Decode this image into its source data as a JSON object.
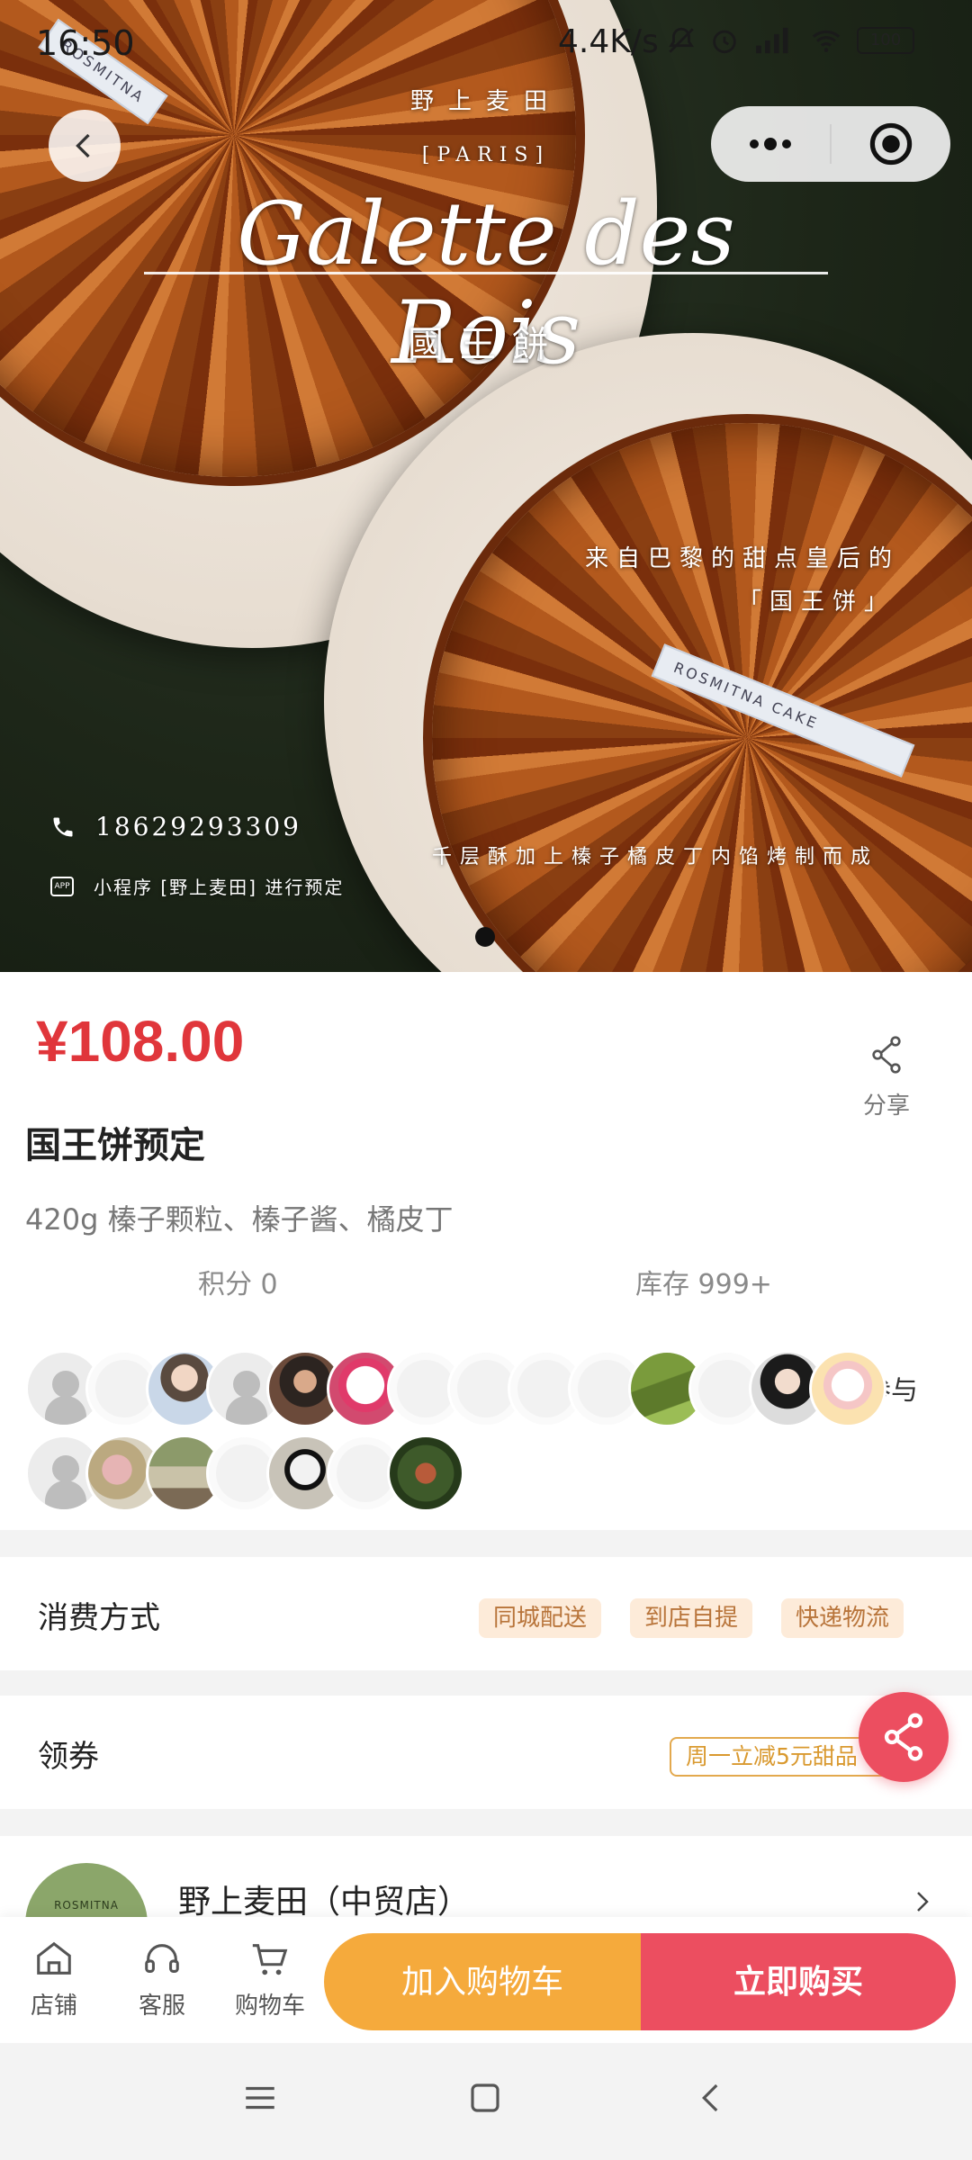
{
  "status_bar": {
    "time": "16:50",
    "net_speed": "4.4K/s",
    "battery": "100"
  },
  "hero": {
    "brand_cn": "野上麦田",
    "brand_city": "[PARIS]",
    "script_title": "Galette des Rois",
    "subtitle_cn": "國王餅",
    "tagline_line1": "来自巴黎的甜点皇后的",
    "tagline_line2": "「国王饼」",
    "tagline_line3": "千层酥加上榛子橘皮丁内馅烤制而成",
    "phone": "18629293309",
    "app_note": "小程序 [野上麦田] 进行预定",
    "app_badge": "APP",
    "ribbon_text_1": "ROSMITNA",
    "ribbon_text_2": "ROSMITNA  CAKE",
    "carousel_index": 1,
    "carousel_total": 1
  },
  "product": {
    "price": "¥108.00",
    "share_label": "分享",
    "title": "国王饼预定",
    "description": "420g 榛子颗粒、榛子酱、橘皮丁",
    "points": "积分 0",
    "stock": "库存 999+",
    "join_label": "参与"
  },
  "participants": {
    "row1": [
      "default",
      "ghost",
      "photo-girl",
      "default",
      "photo-woman",
      "photo-dog",
      "ghost",
      "ghost",
      "ghost",
      "ghost",
      "photo-room",
      "ghost",
      "photo-girl2",
      "photo-cartoon"
    ],
    "row2": [
      "default",
      "photo-flowers",
      "photo-kid",
      "ghost",
      "photo-dogsun",
      "ghost",
      "photo-plant"
    ]
  },
  "consumption": {
    "label": "消费方式",
    "options": [
      "同城配送",
      "到店自提",
      "快递物流"
    ]
  },
  "coupon": {
    "label": "领券",
    "text": "周一立减5元甜品"
  },
  "store": {
    "name": "野上麦田（中贸店）",
    "logo_text": "ROSMITNA"
  },
  "bottom_bar": {
    "tab_store": "店铺",
    "tab_service": "客服",
    "tab_cart": "购物车",
    "add_to_cart": "加入购物车",
    "buy_now": "立即购买"
  },
  "colors": {
    "price": "#e0363b",
    "cart": "#f5aa3c",
    "buy": "#ec4e60",
    "pill_bg": "#fdebd9",
    "pill_text": "#b8743a"
  }
}
